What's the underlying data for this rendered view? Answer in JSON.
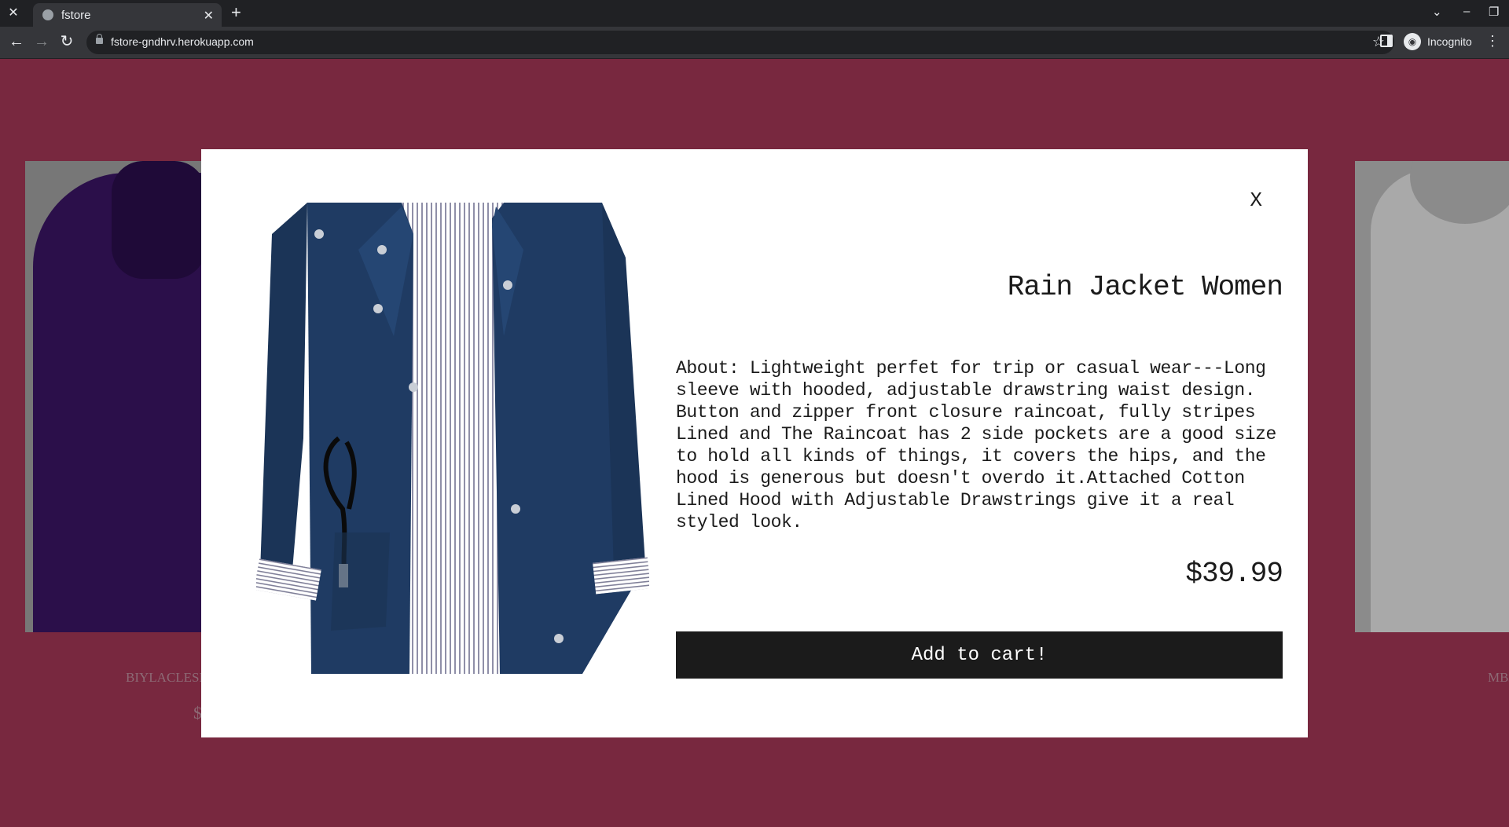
{
  "browser": {
    "tab_title": "fstore",
    "url": "fstore-gndhrv.herokuapp.com",
    "profile_label": "Incognito"
  },
  "background": {
    "left_card_label": "BIYLACLESE",
    "left_card_price": "$",
    "right_card_label": "MBJ"
  },
  "modal": {
    "close_label": "X",
    "title": "Rain Jacket Women",
    "description": "About: Lightweight perfet for trip or casual wear---Long sleeve with hooded, adjustable drawstring waist design. Button and zipper front closure raincoat, fully stripes Lined and The Raincoat has 2 side pockets are a good size to hold all kinds of things, it covers the hips, and the hood is generous but doesn't overdo it.Attached Cotton Lined Hood with Adjustable Drawstrings give it a real styled look.",
    "price": "$39.99",
    "add_to_cart_label": "Add to cart!"
  },
  "colors": {
    "page_background": "#78283f",
    "modal_background": "#ffffff",
    "button_background": "#1b1b1b",
    "jacket_navy": "#1f3b63"
  }
}
